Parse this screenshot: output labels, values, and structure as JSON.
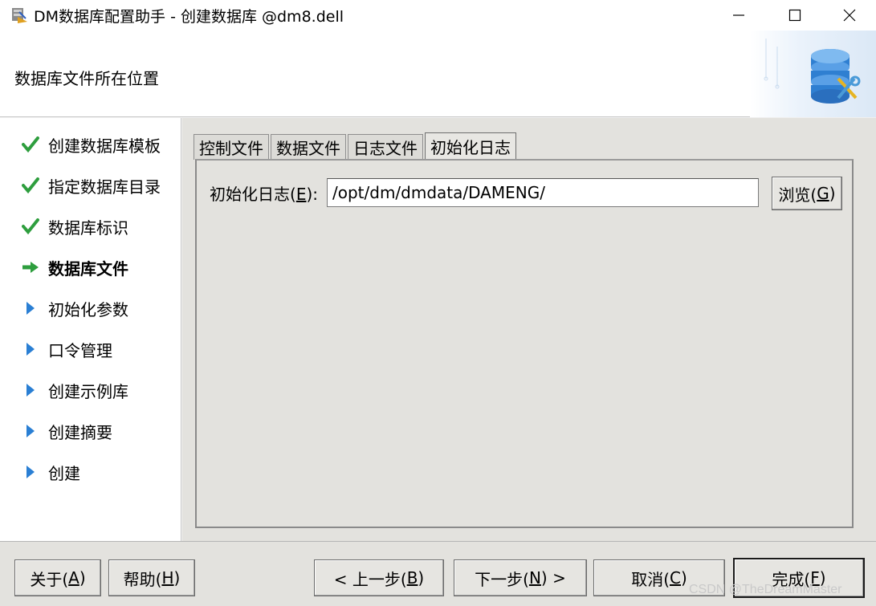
{
  "window": {
    "title": "DM数据库配置助手 - 创建数据库 @dm8.dell",
    "controls": [
      "minimize-icon",
      "maximize-icon",
      "close-icon"
    ]
  },
  "header": {
    "title": "数据库文件所在位置",
    "art_icon": "database-gear-icon"
  },
  "steps": [
    {
      "label": "创建数据库模板",
      "state": "done"
    },
    {
      "label": "指定数据库目录",
      "state": "done"
    },
    {
      "label": "数据库标识",
      "state": "done"
    },
    {
      "label": "数据库文件",
      "state": "current"
    },
    {
      "label": "初始化参数",
      "state": "pending"
    },
    {
      "label": "口令管理",
      "state": "pending"
    },
    {
      "label": "创建示例库",
      "state": "pending"
    },
    {
      "label": "创建摘要",
      "state": "pending"
    },
    {
      "label": "创建",
      "state": "pending"
    }
  ],
  "tabs": [
    {
      "label": "控制文件",
      "active": false
    },
    {
      "label": "数据文件",
      "active": false
    },
    {
      "label": "日志文件",
      "active": false
    },
    {
      "label": "初始化日志",
      "active": true
    }
  ],
  "init_log": {
    "label_text": "初始化日志(",
    "label_mnemonic": "E",
    "label_suffix": "):",
    "value": "/opt/dm/dmdata/DAMENG/",
    "browse_text": "浏览(",
    "browse_mnemonic": "G",
    "browse_suffix": ")"
  },
  "buttons": {
    "about": {
      "text": "关于(",
      "mnemonic": "A",
      "suffix": ")"
    },
    "help": {
      "text": "帮助(",
      "mnemonic": "H",
      "suffix": ")"
    },
    "prev": {
      "text": "< 上一步(",
      "mnemonic": "B",
      "suffix": ")"
    },
    "next": {
      "text": "下一步(",
      "mnemonic": "N",
      "suffix": ") >"
    },
    "cancel": {
      "text": "取消(",
      "mnemonic": "C",
      "suffix": ")"
    },
    "finish": {
      "text": "完成(",
      "mnemonic": "F",
      "suffix": ")"
    }
  },
  "watermark": "CSDN @TheDreamMaster",
  "colors": {
    "check_green": "#2e9e3e",
    "arrow_green": "#2e9e3e",
    "triangle_blue": "#2a7fd4"
  }
}
